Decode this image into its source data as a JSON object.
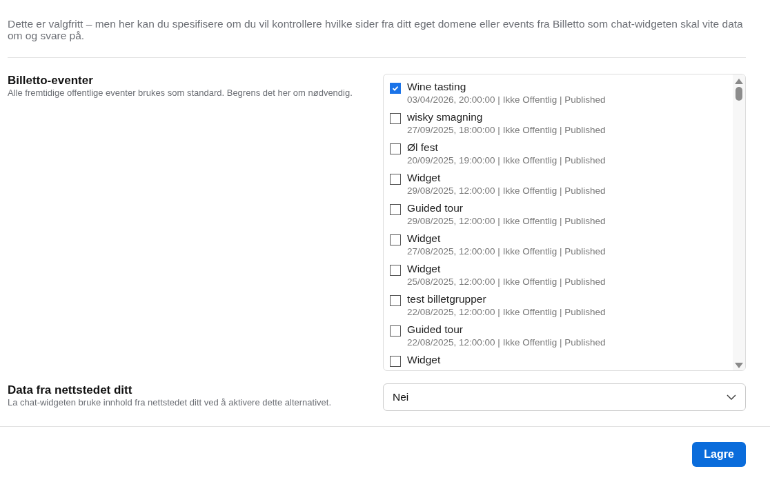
{
  "intro": "Dette er valgfritt – men her kan du spesifisere om du vil kontrollere hvilke sider fra ditt eget domene eller events fra Billetto som chat-widgeten skal vite data om og svare på.",
  "events_section": {
    "title": "Billetto-eventer",
    "description": "Alle fremtidige offentlige eventer brukes som standard. Begrens det her om nødvendig.",
    "events": [
      {
        "name": "Wine tasting",
        "details": "03/04/2026, 20:00:00 | Ikke Offentlig | Published",
        "checked": true
      },
      {
        "name": "wisky smagning",
        "details": "27/09/2025, 18:00:00 | Ikke Offentlig | Published",
        "checked": false
      },
      {
        "name": "Øl fest",
        "details": "20/09/2025, 19:00:00 | Ikke Offentlig | Published",
        "checked": false
      },
      {
        "name": "Widget",
        "details": "29/08/2025, 12:00:00 | Ikke Offentlig | Published",
        "checked": false
      },
      {
        "name": "Guided tour",
        "details": "29/08/2025, 12:00:00 | Ikke Offentlig | Published",
        "checked": false
      },
      {
        "name": "Widget",
        "details": "27/08/2025, 12:00:00 | Ikke Offentlig | Published",
        "checked": false
      },
      {
        "name": "Widget",
        "details": "25/08/2025, 12:00:00 | Ikke Offentlig | Published",
        "checked": false
      },
      {
        "name": "test billetgrupper",
        "details": "22/08/2025, 12:00:00 | Ikke Offentlig | Published",
        "checked": false
      },
      {
        "name": "Guided tour",
        "details": "22/08/2025, 12:00:00 | Ikke Offentlig | Published",
        "checked": false
      },
      {
        "name": "Widget",
        "checked": false
      }
    ]
  },
  "website_section": {
    "title": "Data fra nettstedet ditt",
    "description": "La chat-widgeten bruke innhold fra nettstedet ditt ved å aktivere dette alternativet.",
    "value": "Nei"
  },
  "save_button": "Lagre"
}
